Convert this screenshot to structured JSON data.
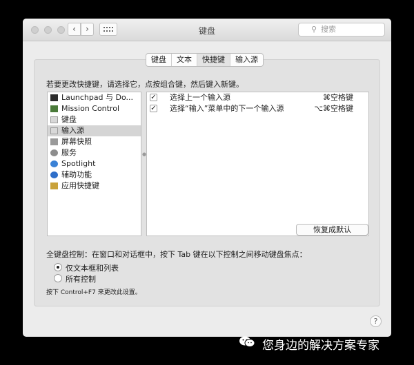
{
  "window": {
    "title": "键盘",
    "search_placeholder": "搜索",
    "back_glyph": "‹",
    "forward_glyph": "›"
  },
  "tabs": [
    "键盘",
    "文本",
    "快捷键",
    "输入源"
  ],
  "active_tab": 2,
  "prompt": "若要更改快捷键，请选择它，点按组合键，然后键入新键。",
  "categories": [
    {
      "label": "Launchpad 与 Do...",
      "icon": "launchpad-icon",
      "color": "#2b2b2b"
    },
    {
      "label": "Mission Control",
      "icon": "mission-control-icon",
      "color": "#4a7a3a"
    },
    {
      "label": "键盘",
      "icon": "keyboard-icon",
      "color": "#d8d8d8"
    },
    {
      "label": "输入源",
      "icon": "input-source-icon",
      "color": "#d8d8d8"
    },
    {
      "label": "屏幕快照",
      "icon": "screenshot-icon",
      "color": "#9a9a9a"
    },
    {
      "label": "服务",
      "icon": "gear-icon",
      "color": "#8d8d8d"
    },
    {
      "label": "Spotlight",
      "icon": "spotlight-icon",
      "color": "#3b82d6"
    },
    {
      "label": "辅助功能",
      "icon": "accessibility-icon",
      "color": "#2f6fc9"
    },
    {
      "label": "应用快捷键",
      "icon": "app-shortcut-icon",
      "color": "#c9a23a"
    }
  ],
  "selected_category": 3,
  "shortcuts": [
    {
      "checked": true,
      "label": "选择上一个输入源",
      "key": "⌘空格键"
    },
    {
      "checked": true,
      "label": "选择“输入”菜单中的下一个输入源",
      "key": "⌥⌘空格键"
    }
  ],
  "check_glyph": "✓",
  "restore_button": "恢复成默认",
  "full_keyboard": {
    "title": "全键盘控制：在窗口和对话框中，按下 Tab 键在以下控制之间移动键盘焦点：",
    "options": [
      "仅文本框和列表",
      "所有控制"
    ],
    "selected": 0
  },
  "note": "按下 Control+F7 来更改此设置。",
  "help_label": "?",
  "watermark": "您身边的解决方案专家",
  "colors": {
    "window_bg": "#ececec",
    "panel_bg": "#e2e2e2",
    "selection": "#d5d5d5",
    "frame": "#000000"
  }
}
